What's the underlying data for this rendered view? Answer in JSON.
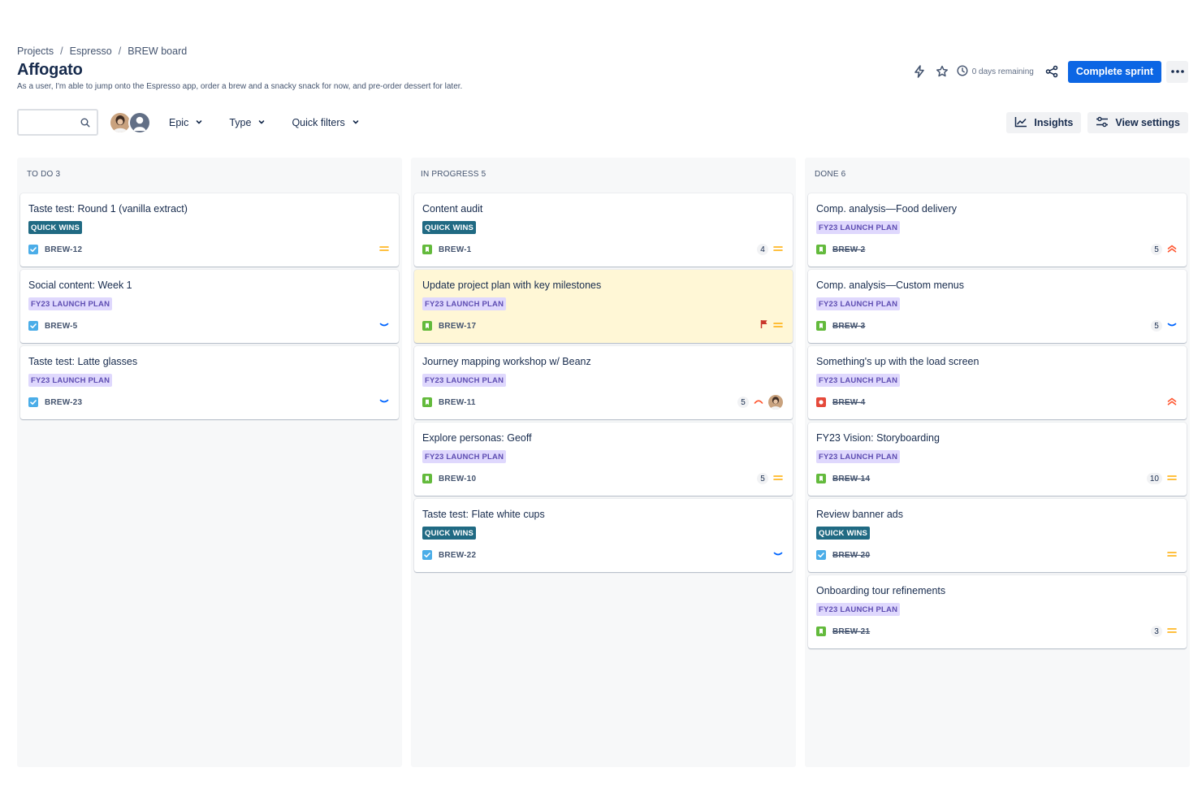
{
  "breadcrumb": [
    "Projects",
    "Espresso",
    "BREW board"
  ],
  "title": "Affogato",
  "description": "As a user, I'm able to jump onto the Espresso app, order a brew and a snacky snack for now, and pre-order dessert for later.",
  "header": {
    "days_remaining": "0 days remaining",
    "complete_sprint_label": "Complete sprint",
    "icons": [
      "lightning-icon",
      "star-icon",
      "clock-icon",
      "share-icon",
      "more-icon"
    ]
  },
  "toolbar": {
    "search_value": "",
    "filters": [
      "Epic",
      "Type",
      "Quick filters"
    ],
    "insights_label": "Insights",
    "view_settings_label": "View settings"
  },
  "colors": {
    "primary": "#0c66e4",
    "quick_wins_bg": "#206a83",
    "fy23_bg": "#dfd8fd",
    "fy23_text": "#5e4db2",
    "flagged_bg": "#fff7d6"
  },
  "columns": [
    {
      "title": "TO DO 3",
      "cards": [
        {
          "title": "Taste test: Round 1 (vanilla extract)",
          "epic": "QUICK WINS",
          "type": "task",
          "key": "BREW-12",
          "done": false,
          "estimate": "",
          "priority": "medium",
          "flag": false,
          "assignee": false
        },
        {
          "title": "Social content: Week 1",
          "epic": "FY23 LAUNCH PLAN",
          "type": "task",
          "key": "BREW-5",
          "done": false,
          "estimate": "",
          "priority": "low",
          "flag": false,
          "assignee": false
        },
        {
          "title": "Taste test: Latte glasses",
          "epic": "FY23 LAUNCH PLAN",
          "type": "task",
          "key": "BREW-23",
          "done": false,
          "estimate": "",
          "priority": "low",
          "flag": false,
          "assignee": false
        }
      ]
    },
    {
      "title": "IN PROGRESS 5",
      "cards": [
        {
          "title": "Content audit",
          "epic": "QUICK WINS",
          "type": "story",
          "key": "BREW-1",
          "done": false,
          "estimate": "4",
          "priority": "medium",
          "flag": false,
          "assignee": false
        },
        {
          "title": "Update project plan with key milestones",
          "epic": "FY23 LAUNCH PLAN",
          "type": "story",
          "key": "BREW-17",
          "done": false,
          "estimate": "",
          "priority": "medium",
          "flag": true,
          "assignee": false
        },
        {
          "title": "Journey mapping workshop w/ Beanz",
          "epic": "FY23 LAUNCH PLAN",
          "type": "story",
          "key": "BREW-11",
          "done": false,
          "estimate": "5",
          "priority": "high",
          "flag": false,
          "assignee": true
        },
        {
          "title": "Explore personas: Geoff",
          "epic": "FY23 LAUNCH PLAN",
          "type": "story",
          "key": "BREW-10",
          "done": false,
          "estimate": "5",
          "priority": "medium",
          "flag": false,
          "assignee": false
        },
        {
          "title": "Taste test: Flate white cups",
          "epic": "QUICK WINS",
          "type": "task",
          "key": "BREW-22",
          "done": false,
          "estimate": "",
          "priority": "low",
          "flag": false,
          "assignee": false
        }
      ]
    },
    {
      "title": "DONE 6",
      "cards": [
        {
          "title": "Comp. analysis—Food delivery",
          "epic": "FY23 LAUNCH PLAN",
          "type": "story",
          "key": "BREW-2",
          "done": true,
          "estimate": "5",
          "priority": "highest",
          "flag": false,
          "assignee": false
        },
        {
          "title": "Comp. analysis—Custom menus",
          "epic": "FY23 LAUNCH PLAN",
          "type": "story",
          "key": "BREW-3",
          "done": true,
          "estimate": "5",
          "priority": "low",
          "flag": false,
          "assignee": false
        },
        {
          "title": "Something's up with the load screen",
          "epic": "FY23 LAUNCH PLAN",
          "type": "bug",
          "key": "BREW-4",
          "done": true,
          "estimate": "",
          "priority": "highest",
          "flag": false,
          "assignee": false
        },
        {
          "title": "FY23 Vision: Storyboarding",
          "epic": "FY23 LAUNCH PLAN",
          "type": "story",
          "key": "BREW-14",
          "done": true,
          "estimate": "10",
          "priority": "medium",
          "flag": false,
          "assignee": false
        },
        {
          "title": "Review banner ads",
          "epic": "QUICK WINS",
          "type": "task",
          "key": "BREW-20",
          "done": true,
          "estimate": "",
          "priority": "medium",
          "flag": false,
          "assignee": false
        },
        {
          "title": "Onboarding tour refinements",
          "epic": "FY23 LAUNCH PLAN",
          "type": "story",
          "key": "BREW-21",
          "done": true,
          "estimate": "3",
          "priority": "medium",
          "flag": false,
          "assignee": false
        }
      ]
    }
  ]
}
